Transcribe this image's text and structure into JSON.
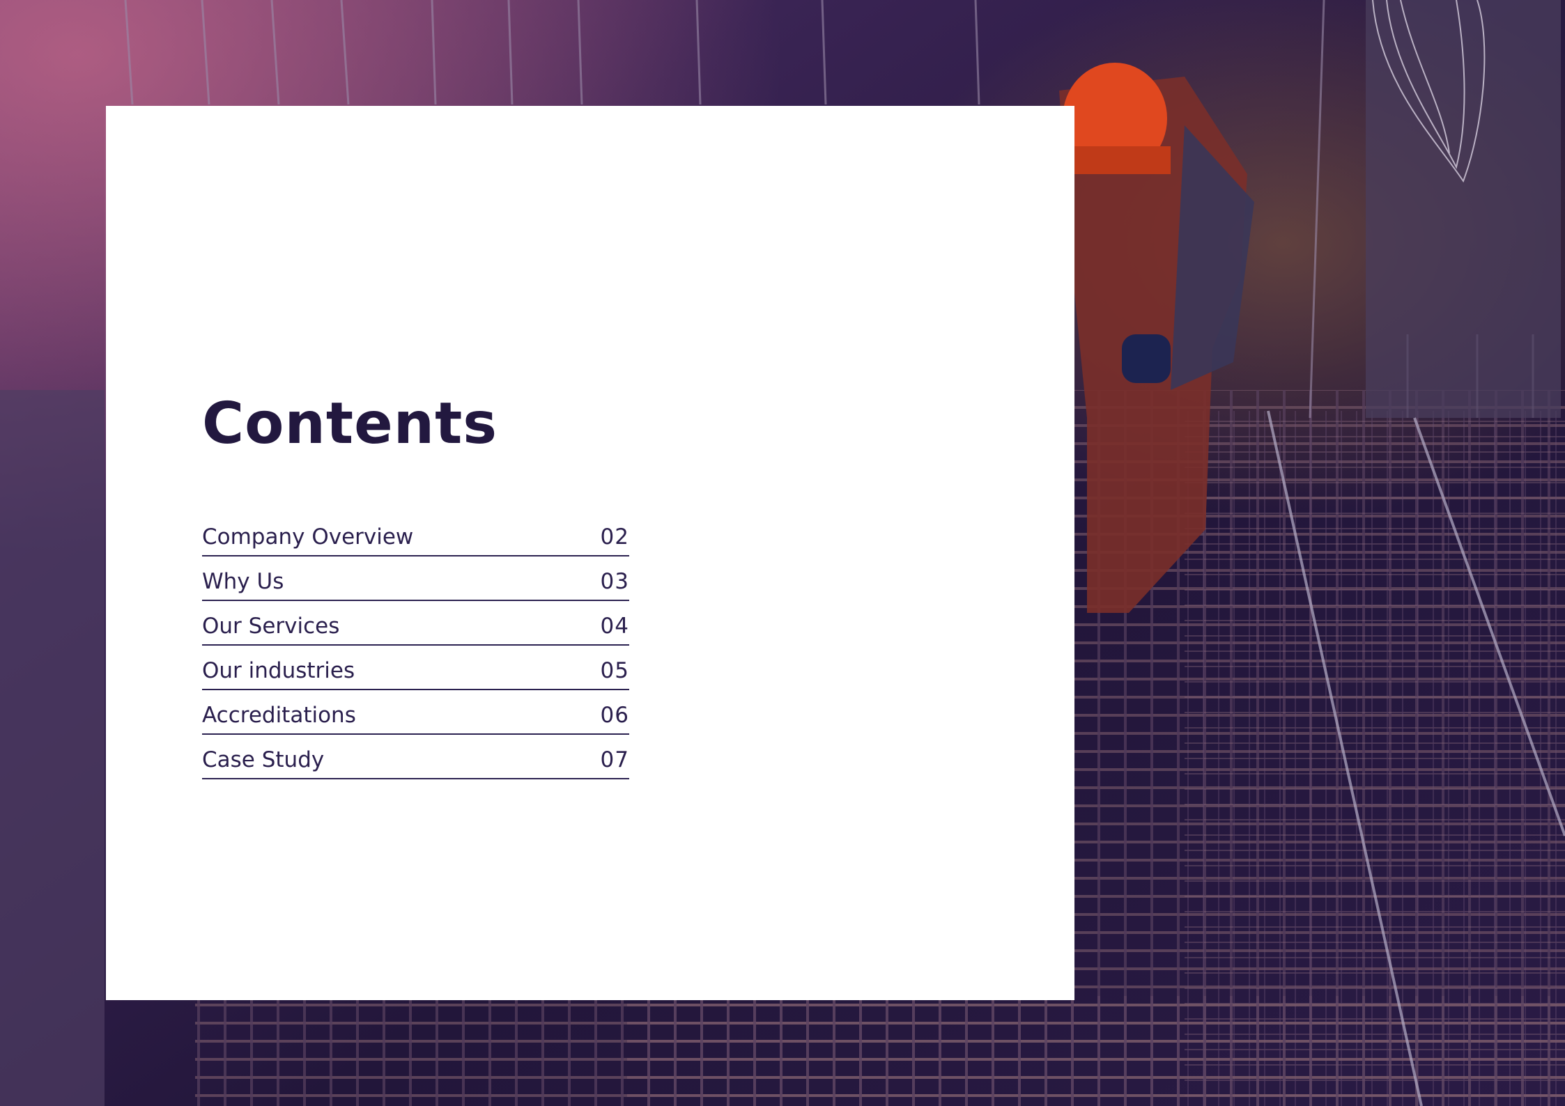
{
  "page": {
    "title": "Contents"
  },
  "toc": [
    {
      "label": "Company Overview",
      "page": "02"
    },
    {
      "label": "Why Us",
      "page": "03"
    },
    {
      "label": "Our Services",
      "page": "04"
    },
    {
      "label": "Our industries",
      "page": "05"
    },
    {
      "label": "Accreditations",
      "page": "06"
    },
    {
      "label": "Case Study",
      "page": "07"
    }
  ],
  "colors": {
    "text_dark": "#22183f",
    "rule_line": "#2b2150",
    "card": "#ffffff",
    "photo_tint": "#2a1850",
    "helmet": "#e0481f"
  },
  "background_image": "construction-worker-rebar-photo"
}
